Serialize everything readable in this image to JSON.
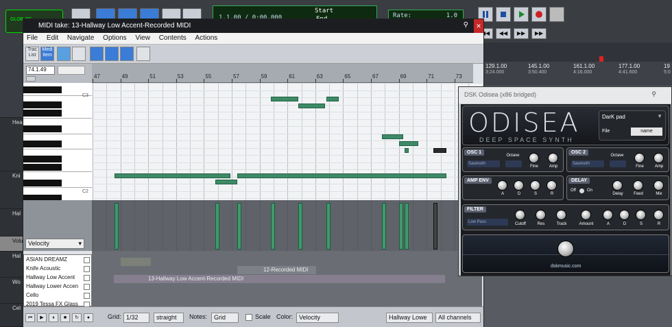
{
  "daw": {
    "glob": "GLOB\nOF",
    "counter": "1.1.00 / 0:00.000",
    "start_label": "Start",
    "end_label": "End",
    "rate_label": "Rate:",
    "rate_value": "1.0",
    "ruler_ticks": [
      {
        "label": "129.1.00",
        "time": "3:24.000"
      },
      {
        "label": "145.1.00",
        "time": "3:50.400"
      },
      {
        "label": "161.1.00",
        "time": "4:16.000"
      },
      {
        "label": "177.1.00",
        "time": "4:41.600"
      },
      {
        "label": "19",
        "time": "5:0"
      }
    ],
    "left_tracks": [
      "Hea",
      "Kni",
      "Hal",
      "Volum",
      "Hal",
      "Wo",
      "Cel"
    ]
  },
  "midi_editor": {
    "title": "MIDI take: 13-Hallway Low Accent-Recorded MIDI",
    "menu": [
      "File",
      "Edit",
      "Navigate",
      "Options",
      "View",
      "Contents",
      "Actions"
    ],
    "toolbar": {
      "track_list": "Trac\nList",
      "media_item": "Medi\nItem"
    },
    "position": "74.1.49",
    "ruler_ticks": [
      "47",
      "49",
      "51",
      "53",
      "55",
      "57",
      "59",
      "61",
      "63",
      "65",
      "67",
      "69",
      "71",
      "73"
    ],
    "key_labels": [
      "C3",
      "C2"
    ],
    "velocity_select": "Velocity",
    "track_list": [
      "ASIAN DREAMZ",
      "Knife Acoustic",
      "Hallway Low Accent",
      "Hallway Lower Accen",
      "Cello",
      "2019 Tessa FX Glass"
    ],
    "clips": [
      "12-Recorded MIDI",
      "13-Hallway Low Accent-Recorded MIDI"
    ],
    "bottom": {
      "grid_label": "Grid:",
      "grid_value": "1/32",
      "straight": "straight",
      "notes_label": "Notes:",
      "notes_value": "Grid",
      "scale_label": "Scale",
      "color_label": "Color:",
      "color_value": "Velocity",
      "channel_track": "Hallway Lowe",
      "channels": "All channels"
    }
  },
  "plugin": {
    "title": "DSK Odisea (x86 bridged)",
    "logo": "ODISEA",
    "subtitle": "DEEP SPACE SYNTH",
    "preset": "DarK pad",
    "file_label": "File",
    "name_label": "name",
    "osc1": {
      "tag": "OSC 1",
      "wave": "Sawtooth",
      "octave": "Octave",
      "fine": "Fine",
      "amp": "Amp"
    },
    "osc2": {
      "tag": "OSC 2",
      "wave": "Sawtooth",
      "octave": "Octave",
      "fine": "Fine",
      "amp": "Amp"
    },
    "amp_env": {
      "tag": "AMP ENV",
      "a": "A",
      "d": "D",
      "s": "S",
      "r": "R"
    },
    "delay": {
      "tag": "DELAY",
      "off": "Off",
      "on": "On",
      "delay": "Delay",
      "feed": "Feed",
      "mix": "Mix"
    },
    "filter": {
      "tag": "FILTER",
      "type": "Low Pass",
      "cutoff": "Cutoff",
      "res": "Res",
      "track": "Track",
      "amount": "Amount",
      "a": "A",
      "d": "D",
      "s": "S",
      "r": "R"
    },
    "url": "dskmusic.com"
  },
  "chart_data": {
    "type": "scatter",
    "title": "",
    "notes": [
      {
        "bar": 48.6,
        "length": 8.3,
        "pitch": "C2+"
      },
      {
        "bar": 55.8,
        "length": 1.6,
        "pitch": "C2"
      },
      {
        "bar": 57.4,
        "length": 15.0,
        "pitch": "C2+"
      },
      {
        "bar": 59.8,
        "length": 2.0,
        "pitch": "C3+"
      },
      {
        "bar": 61.8,
        "length": 1.9,
        "pitch": "C3"
      },
      {
        "bar": 63.8,
        "length": 0.9,
        "pitch": "C3+"
      },
      {
        "bar": 67.8,
        "length": 1.5,
        "pitch": "G2"
      },
      {
        "bar": 69.0,
        "length": 1.4,
        "pitch": "F2"
      },
      {
        "bar": 69.4,
        "length": 0.3,
        "pitch": "E2"
      },
      {
        "bar": 71.5,
        "length": 0.9,
        "pitch": "E2",
        "selected": true
      }
    ]
  }
}
